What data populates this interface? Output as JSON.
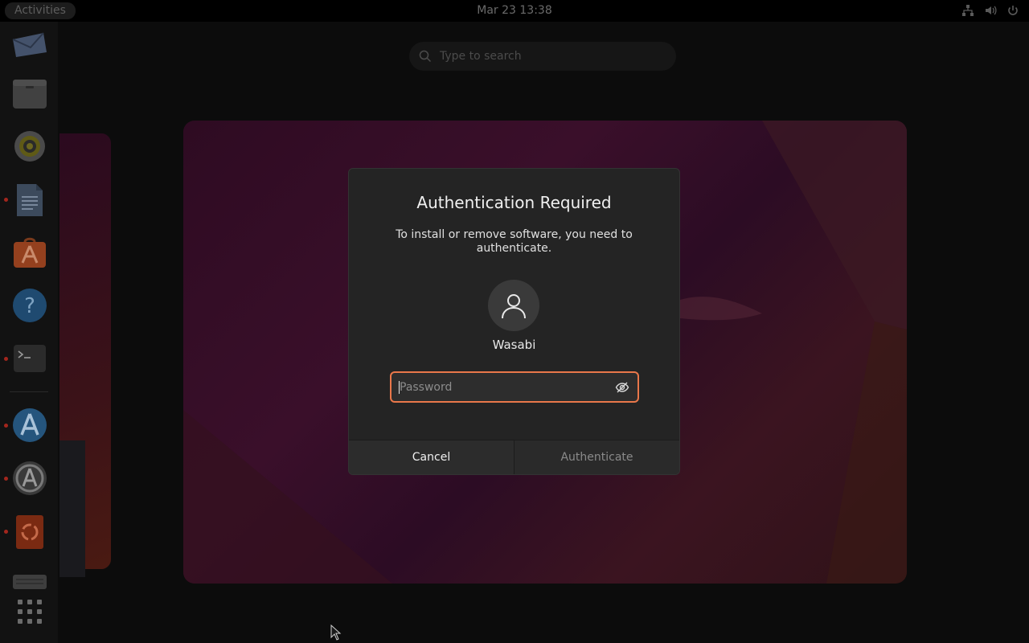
{
  "topbar": {
    "activities_label": "Activities",
    "clock": "Mar 23  13:38",
    "tray_icons": [
      "network-icon",
      "volume-icon",
      "power-icon"
    ]
  },
  "dock": {
    "items": [
      {
        "name": "thunderbird-icon",
        "running": false
      },
      {
        "name": "files-icon",
        "running": false
      },
      {
        "name": "rhythmbox-icon",
        "running": false
      },
      {
        "name": "writer-icon",
        "running": true
      },
      {
        "name": "software-store-icon",
        "running": false
      },
      {
        "name": "help-icon",
        "running": false
      },
      {
        "name": "terminal-icon",
        "running": true
      },
      {
        "name": "app-center-icon",
        "running": true
      },
      {
        "name": "software-updater-icon",
        "running": true
      },
      {
        "name": "ubuntu-installer-icon",
        "running": true
      },
      {
        "name": "drive-icon",
        "running": false
      }
    ],
    "show_apps": "show-apps-icon"
  },
  "search": {
    "placeholder": "Type to search"
  },
  "dialog": {
    "title": "Authentication Required",
    "message": "To install or remove software, you need to authenticate.",
    "user": "Wasabi",
    "password_placeholder": "Password",
    "cancel_label": "Cancel",
    "authenticate_label": "Authenticate"
  },
  "colors": {
    "accent": "#e9774a",
    "dialog_bg": "#242424",
    "run_indicator": "#a3261d"
  }
}
